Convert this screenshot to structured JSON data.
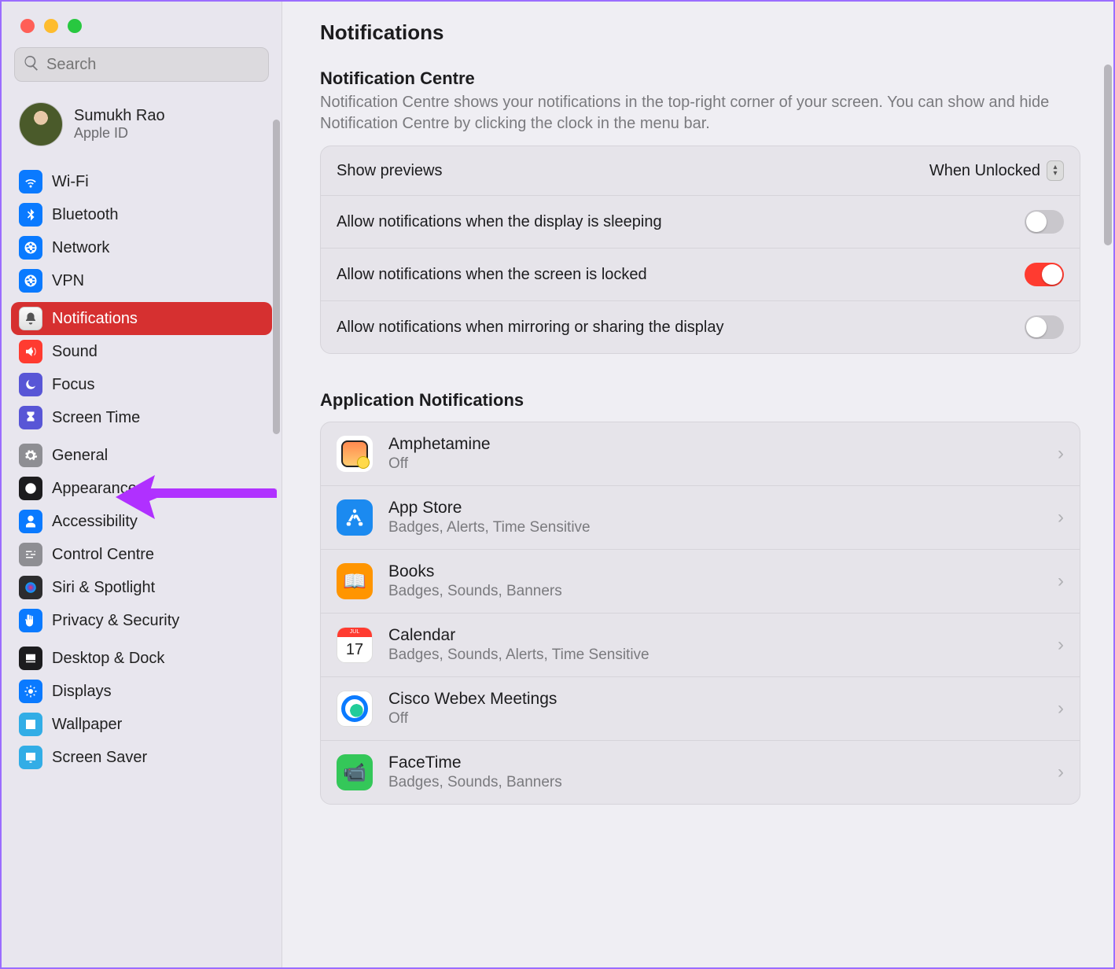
{
  "title": "Notifications",
  "search_placeholder": "Search",
  "profile": {
    "name": "Sumukh Rao",
    "sub": "Apple ID"
  },
  "sidebar": {
    "groups": [
      [
        {
          "label": "Wi-Fi",
          "icon": "wifi",
          "cls": "ic-blue"
        },
        {
          "label": "Bluetooth",
          "icon": "bluetooth",
          "cls": "ic-blue"
        },
        {
          "label": "Network",
          "icon": "globe",
          "cls": "ic-blue"
        },
        {
          "label": "VPN",
          "icon": "globe",
          "cls": "ic-blue"
        }
      ],
      [
        {
          "label": "Notifications",
          "icon": "bell",
          "cls": "ic-red",
          "selected": true
        },
        {
          "label": "Sound",
          "icon": "speaker",
          "cls": "ic-red"
        },
        {
          "label": "Focus",
          "icon": "moon",
          "cls": "ic-purple"
        },
        {
          "label": "Screen Time",
          "icon": "hourglass",
          "cls": "ic-purple"
        }
      ],
      [
        {
          "label": "General",
          "icon": "gear",
          "cls": "ic-gray"
        },
        {
          "label": "Appearance",
          "icon": "appearance",
          "cls": "ic-black"
        },
        {
          "label": "Accessibility",
          "icon": "person",
          "cls": "ic-blue"
        },
        {
          "label": "Control Centre",
          "icon": "sliders",
          "cls": "ic-gray"
        },
        {
          "label": "Siri & Spotlight",
          "icon": "siri",
          "cls": "ic-dark"
        },
        {
          "label": "Privacy & Security",
          "icon": "hand",
          "cls": "ic-blue"
        }
      ],
      [
        {
          "label": "Desktop & Dock",
          "icon": "dock",
          "cls": "ic-black"
        },
        {
          "label": "Displays",
          "icon": "sun",
          "cls": "ic-blue"
        },
        {
          "label": "Wallpaper",
          "icon": "wallpaper",
          "cls": "ic-teal"
        },
        {
          "label": "Screen Saver",
          "icon": "screensaver",
          "cls": "ic-teal"
        }
      ]
    ]
  },
  "notif_centre": {
    "title": "Notification Centre",
    "desc": "Notification Centre shows your notifications in the top-right corner of your screen. You can show and hide Notification Centre by clicking the clock in the menu bar."
  },
  "settings": [
    {
      "label": "Show previews",
      "type": "select",
      "value": "When Unlocked"
    },
    {
      "label": "Allow notifications when the display is sleeping",
      "type": "toggle",
      "on": false
    },
    {
      "label": "Allow notifications when the screen is locked",
      "type": "toggle",
      "on": true
    },
    {
      "label": "Allow notifications when mirroring or sharing the display",
      "type": "toggle",
      "on": false
    }
  ],
  "apps_title": "Application Notifications",
  "apps": [
    {
      "name": "Amphetamine",
      "sub": "Off",
      "icon_bg": "#fff",
      "icon_inner": "linear-gradient(#ff8a50,#ffcc70)",
      "glyph": ""
    },
    {
      "name": "App Store",
      "sub": "Badges, Alerts, Time Sensitive",
      "icon_bg": "#1b8af0",
      "glyph": "A",
      "glyph_color": "#fff"
    },
    {
      "name": "Books",
      "sub": "Badges, Sounds, Banners",
      "icon_bg": "#ff9500",
      "glyph": "📖",
      "glyph_color": "#fff"
    },
    {
      "name": "Calendar",
      "sub": "Badges, Sounds, Alerts, Time Sensitive",
      "icon_bg": "#fff",
      "glyph": "17",
      "glyph_color": "#222",
      "top_strip": "#ff3b30"
    },
    {
      "name": "Cisco Webex Meetings",
      "sub": "Off",
      "icon_bg": "#fff",
      "glyph": "◯",
      "glyph_color": "#0a7aff"
    },
    {
      "name": "FaceTime",
      "sub": "Badges, Sounds, Banners",
      "icon_bg": "#34c759",
      "glyph": "📹",
      "glyph_color": "#fff"
    }
  ]
}
